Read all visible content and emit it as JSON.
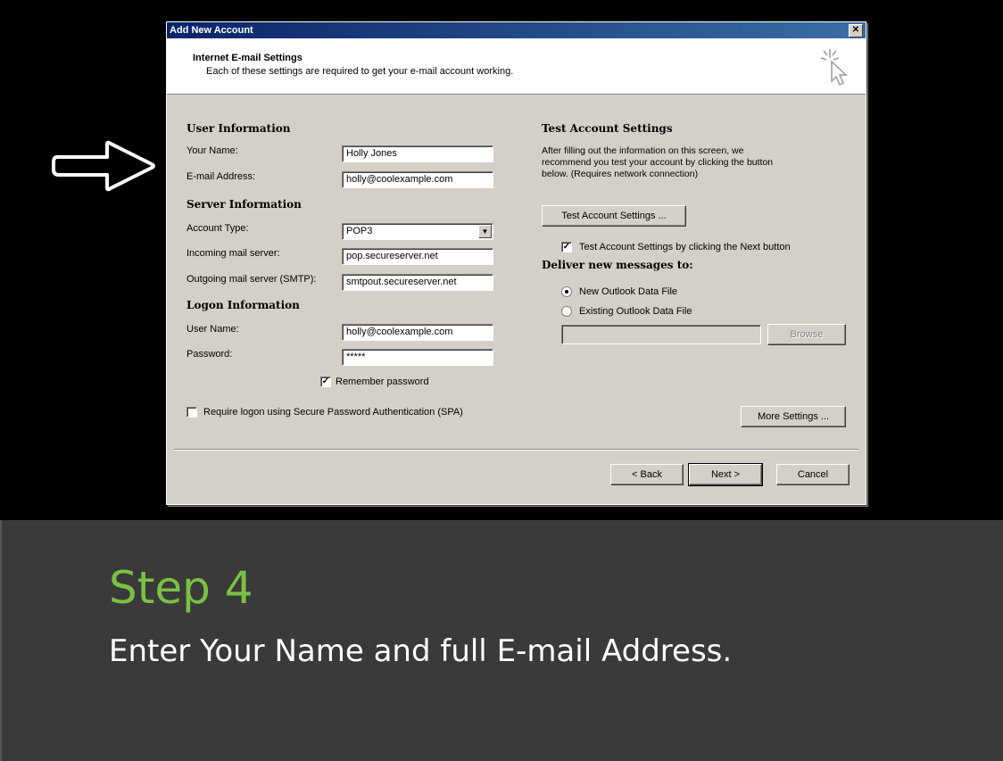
{
  "dialog": {
    "title": "Add New Account",
    "header_title": "Internet E-mail Settings",
    "header_subtitle": "Each of these settings are required to get your e-mail account working."
  },
  "user_info": {
    "section": "User Information",
    "your_name_label": "Your Name:",
    "your_name_value": "Holly Jones",
    "email_label": "E-mail Address:",
    "email_value": "holly@coolexample.com"
  },
  "server_info": {
    "section": "Server Information",
    "account_type_label": "Account Type:",
    "account_type_value": "POP3",
    "incoming_label": "Incoming mail server:",
    "incoming_value": "pop.secureserver.net",
    "outgoing_label": "Outgoing mail server (SMTP):",
    "outgoing_value": "smtpout.secureserver.net"
  },
  "logon_info": {
    "section": "Logon Information",
    "username_label": "User Name:",
    "username_value": "holly@coolexample.com",
    "password_label": "Password:",
    "password_value": "*****",
    "remember_label": "Remember password",
    "remember_checked": true,
    "spa_label": "Require logon using Secure Password Authentication (SPA)",
    "spa_checked": false
  },
  "test_settings": {
    "section": "Test Account Settings",
    "description_line1": "After filling out the information on this screen, we",
    "description_line2": "recommend you test your account by clicking the button",
    "description_line3": "below. (Requires network connection)",
    "test_button": "Test Account Settings ...",
    "test_on_next_label": "Test Account Settings by clicking the Next button",
    "test_on_next_checked": true,
    "deliver_label": "Deliver new messages to:",
    "new_file_label": "New Outlook Data File",
    "existing_file_label": "Existing Outlook Data File",
    "selected_option": "New Outlook Data File",
    "existing_file_value": "",
    "browse_button": "Browse"
  },
  "buttons": {
    "more_settings": "More Settings ...",
    "back": "< Back",
    "next": "Next >",
    "cancel": "Cancel",
    "close": "✕"
  },
  "slide": {
    "step_title": "Step 4",
    "step_text": "Enter Your Name and full E-mail Address.",
    "step_title_color": "#7ac143"
  }
}
